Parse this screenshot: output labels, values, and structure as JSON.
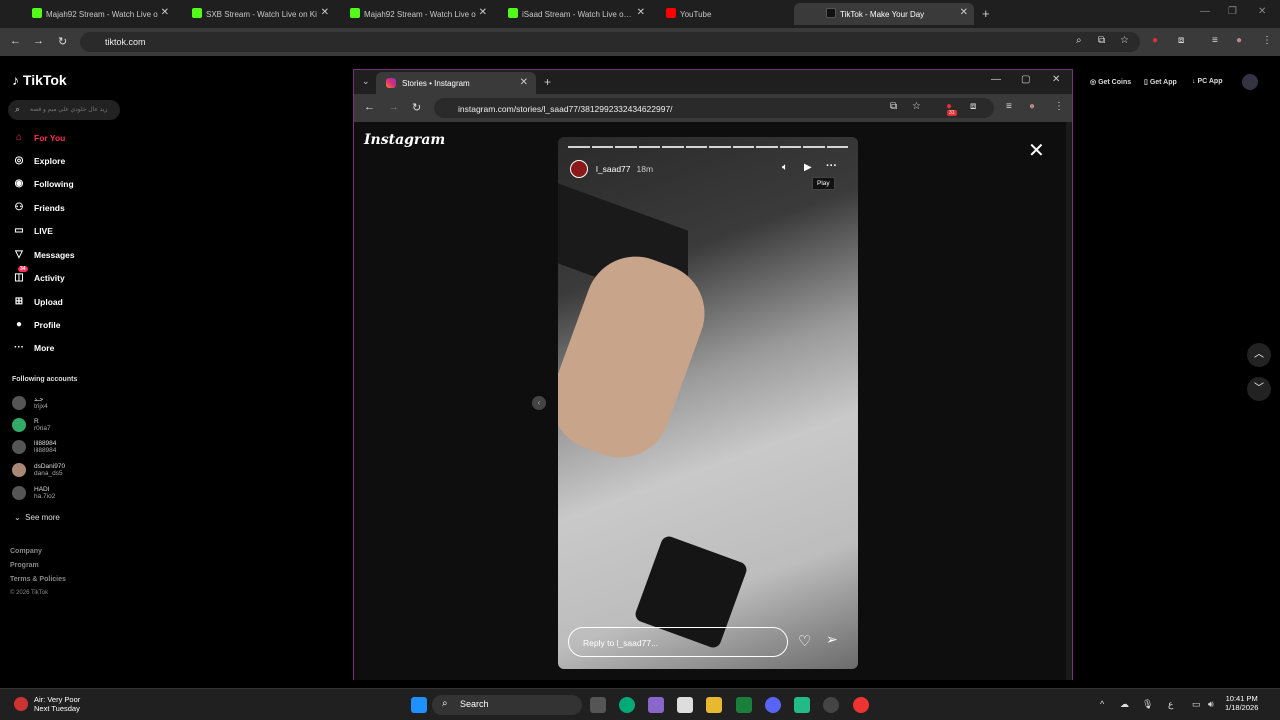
{
  "browser": {
    "tabs": [
      {
        "title": "Majah92 Stream - Watch Live o",
        "icon": "kick-icon"
      },
      {
        "title": "SXB Stream - Watch Live on Ki",
        "icon": "kick-icon"
      },
      {
        "title": "Majah92 Stream - Watch Live o",
        "icon": "kick-icon"
      },
      {
        "title": "iSaad Stream - Watch Live on K",
        "icon": "kick-icon"
      },
      {
        "title": "YouTube",
        "icon": "youtube-icon"
      },
      {
        "title": "TikTok - Make Your Day",
        "icon": "tiktok-icon",
        "active": true
      }
    ],
    "url": "tiktok.com"
  },
  "tiktok": {
    "logo": "TikTok",
    "search_placeholder": "زيد عال خلودي علي ميم و قصة",
    "nav": [
      {
        "label": "For You",
        "icon": "home-icon",
        "active": true
      },
      {
        "label": "Explore",
        "icon": "compass-icon"
      },
      {
        "label": "Following",
        "icon": "following-icon"
      },
      {
        "label": "Friends",
        "icon": "friends-icon"
      },
      {
        "label": "LIVE",
        "icon": "live-icon"
      },
      {
        "label": "Messages",
        "icon": "messages-icon"
      },
      {
        "label": "Activity",
        "icon": "activity-icon",
        "badge": "34"
      },
      {
        "label": "Upload",
        "icon": "upload-icon"
      },
      {
        "label": "Profile",
        "icon": "profile-icon"
      },
      {
        "label": "More",
        "icon": "more-icon"
      }
    ],
    "following_heading": "Following accounts",
    "following": [
      {
        "name": "جـد",
        "handle": "trijx4"
      },
      {
        "name": "R",
        "handle": "r0ria7"
      },
      {
        "name": "lil88984",
        "handle": "lil88984"
      },
      {
        "name": "dsDani970",
        "handle": "dana_ds5"
      },
      {
        "name": "HADI",
        "handle": "ha.7io2"
      }
    ],
    "see_more": "See more",
    "footer": [
      "Company",
      "Program",
      "Terms & Policies",
      "© 2026 TikTok"
    ],
    "top_buttons": [
      "Get Coins",
      "Get App",
      "PC App"
    ]
  },
  "popup": {
    "tab_title": "Stories • Instagram",
    "url": "instagram.com/stories/l_saad77/3812992332434622997/",
    "ext_badge": "31"
  },
  "instagram": {
    "logo": "Instagram",
    "story_user": "l_saad77",
    "story_time": "18m",
    "tooltip": "Play",
    "reply_placeholder": "Reply to l_saad77...",
    "progress_segments": 12
  },
  "taskbar": {
    "weather_line1": "Air: Very Poor",
    "weather_line2": "Next Tuesday",
    "search": "Search",
    "time": "10:41 PM",
    "date": "1/18/2026"
  }
}
